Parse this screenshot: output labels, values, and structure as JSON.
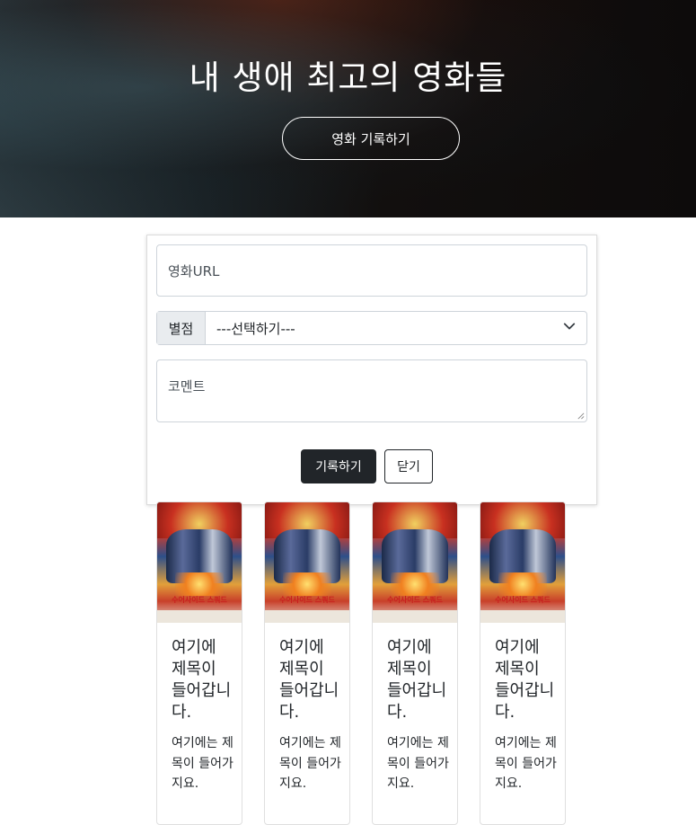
{
  "hero": {
    "title": "내 생애 최고의 영화들",
    "button_label": "영화 기록하기"
  },
  "form": {
    "url_placeholder": "영화URL",
    "rating_label": "별점",
    "rating_selected": "---선택하기---",
    "comment_placeholder": "코멘트",
    "submit_label": "기록하기",
    "close_label": "닫기"
  },
  "cards": [
    {
      "poster_title": "수어사이드 스쿼드",
      "title": "여기에 제목이 들어갑니다.",
      "text": "여기에는 제목이 들어가지요."
    },
    {
      "poster_title": "수어사이드 스쿼드",
      "title": "여기에 제목이 들어갑니다.",
      "text": "여기에는 제목이 들어가지요."
    },
    {
      "poster_title": "수어사이드 스쿼드",
      "title": "여기에 제목이 들어갑니다.",
      "text": "여기에는 제목이 들어가지요."
    },
    {
      "poster_title": "수어사이드 스쿼드",
      "title": "여기에 제목이 들어갑니다.",
      "text": "여기에는 제목이 들어가지요."
    }
  ],
  "colors": {
    "dark_button": "#212529",
    "border": "#ced4da",
    "addon_bg": "#e9ecef"
  }
}
